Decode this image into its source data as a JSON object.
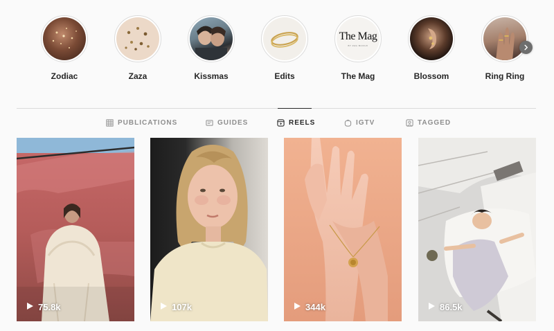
{
  "highlights": [
    {
      "label": "Zodiac"
    },
    {
      "label": "Zaza"
    },
    {
      "label": "Kissmas"
    },
    {
      "label": "Edits"
    },
    {
      "label": "The Mag",
      "cover_title": "The Mag",
      "cover_subtitle": "BY ZAG BIJOUX"
    },
    {
      "label": "Blossom"
    },
    {
      "label": "Ring Ring"
    }
  ],
  "highlights_next_icon": "chevron-right-icon",
  "tabs": [
    {
      "label": "PUBLICATIONS",
      "icon": "grid-icon",
      "active": false
    },
    {
      "label": "GUIDES",
      "icon": "guide-icon",
      "active": false
    },
    {
      "label": "REELS",
      "icon": "reels-icon",
      "active": true
    },
    {
      "label": "IGTV",
      "icon": "igtv-icon",
      "active": false
    },
    {
      "label": "TAGGED",
      "icon": "tagged-icon",
      "active": false
    }
  ],
  "reels": [
    {
      "views": "75.8k",
      "description": "model in white fur coat against pink drape"
    },
    {
      "views": "107k",
      "description": "portrait of woman in cream top"
    },
    {
      "views": "344k",
      "description": "hands with gold chain bracelet on peach background"
    },
    {
      "views": "86.5k",
      "description": "person lying on white bed seen from above"
    }
  ],
  "colors": {
    "background": "#fafafa",
    "text_primary": "#262626",
    "text_secondary": "#8e8e8e",
    "divider": "#dbdbdb"
  }
}
